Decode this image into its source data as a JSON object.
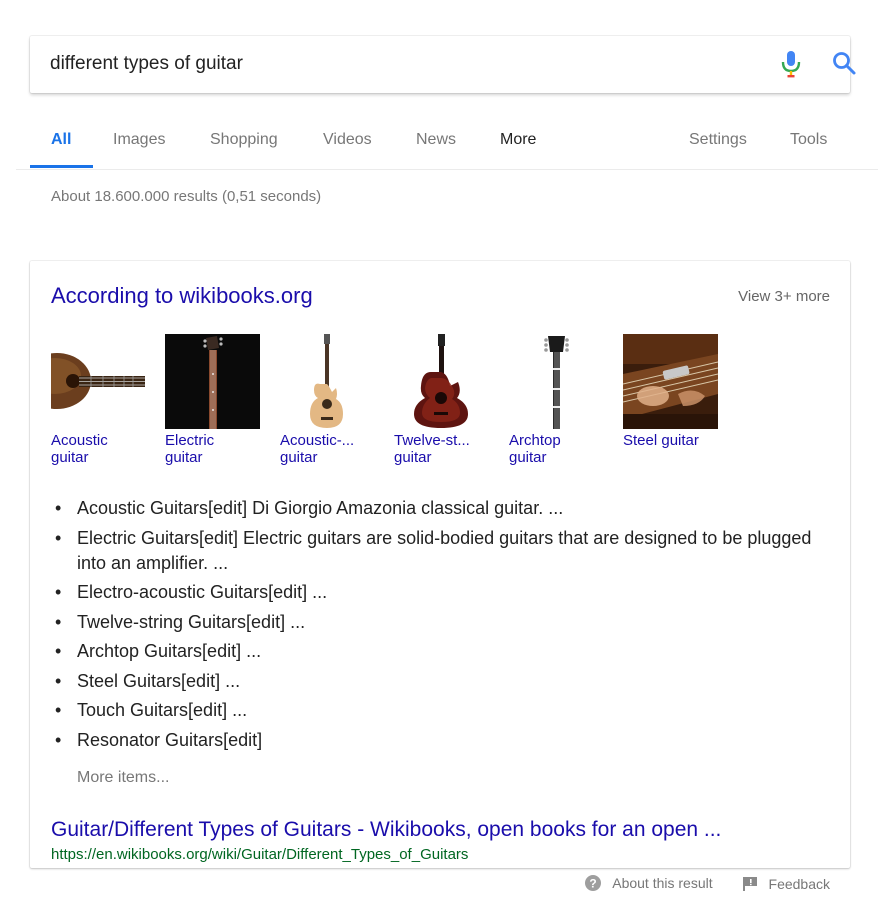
{
  "search": {
    "query": "different types of guitar"
  },
  "icons": {
    "mic": "microphone-icon",
    "search": "search-icon",
    "help": "help-circle-icon",
    "feedback": "flag-icon"
  },
  "colors": {
    "accent": "#1a73e8",
    "link": "#1a0dab",
    "url": "#006621",
    "muted": "#777777"
  },
  "tabs": [
    {
      "label": "All",
      "active": true
    },
    {
      "label": "Images"
    },
    {
      "label": "Shopping"
    },
    {
      "label": "Videos"
    },
    {
      "label": "News"
    },
    {
      "label": "More"
    },
    {
      "label": "Settings"
    },
    {
      "label": "Tools"
    }
  ],
  "stats": "About 18.600.000 results (0,51 seconds)",
  "card": {
    "title": "According to wikibooks.org",
    "view_more": "View 3+ more",
    "thumbnails": [
      {
        "line1": "Acoustic",
        "line2": "guitar"
      },
      {
        "line1": "Electric",
        "line2": "guitar"
      },
      {
        "line1": "Acoustic-...",
        "line2": "guitar"
      },
      {
        "line1": "Twelve-st...",
        "line2": "guitar"
      },
      {
        "line1": "Archtop",
        "line2": "guitar"
      },
      {
        "line1": "Steel guitar",
        "line2": ""
      }
    ],
    "list": [
      "Acoustic Guitars[edit] Di Giorgio Amazonia classical guitar. ...",
      "Electric Guitars[edit] Electric guitars are solid-bodied guitars that are designed to be plugged into an amplifier. ...",
      "Electro-acoustic Guitars[edit] ...",
      "Twelve-string Guitars[edit] ...",
      "Archtop Guitars[edit] ...",
      "Steel Guitars[edit] ...",
      "Touch Guitars[edit] ...",
      "Resonator Guitars[edit]"
    ],
    "more_items": "More items...",
    "result_title": "Guitar/Different Types of Guitars - Wikibooks, open books for an open ...",
    "result_url": "https://en.wikibooks.org/wiki/Guitar/Different_Types_of_Guitars"
  },
  "footer": {
    "about": "About this result",
    "feedback": "Feedback"
  }
}
